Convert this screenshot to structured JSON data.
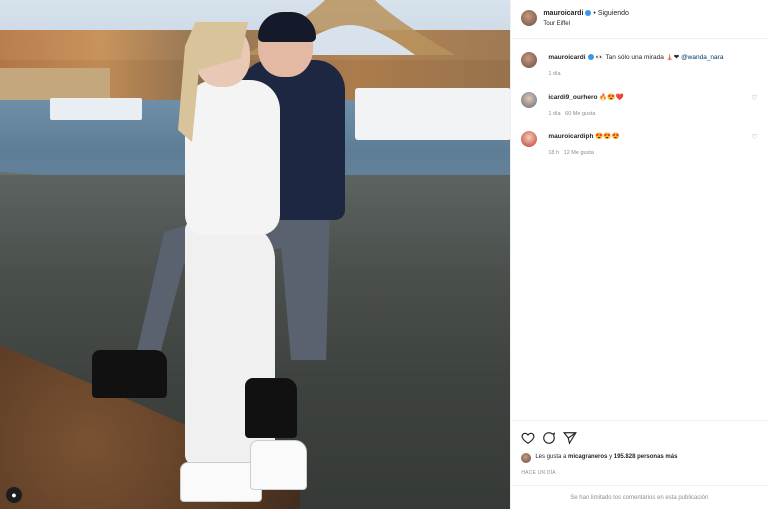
{
  "post": {
    "author": "mauroicardi",
    "follow_state": "Siguiendo",
    "location": "Tour Eiffel",
    "dot": "•"
  },
  "caption": {
    "author": "mauroicardi",
    "text": "Tan sólo una mirada",
    "mention": "@wanda_nara",
    "time": "1 día"
  },
  "comments": [
    {
      "author": "icardi9_ourhero",
      "text": "🔥😍❤️",
      "time": "1 día",
      "likes": "60 Me gusta"
    },
    {
      "author": "mauroicardiph",
      "text": "😍😍😍",
      "time": "18 h",
      "likes": "12 Me gusta"
    }
  ],
  "likes_line": {
    "prefix": "Les gusta a",
    "user": "micagraneros",
    "middle": "y",
    "count": "195.828 personas más"
  },
  "posted": "HACE UN DÍA",
  "comments_limited": "Se han limitado los comentarios en esta publicación",
  "colors": {
    "accent": "#3897f0",
    "muted": "#8e8e8e",
    "text": "#262626"
  }
}
